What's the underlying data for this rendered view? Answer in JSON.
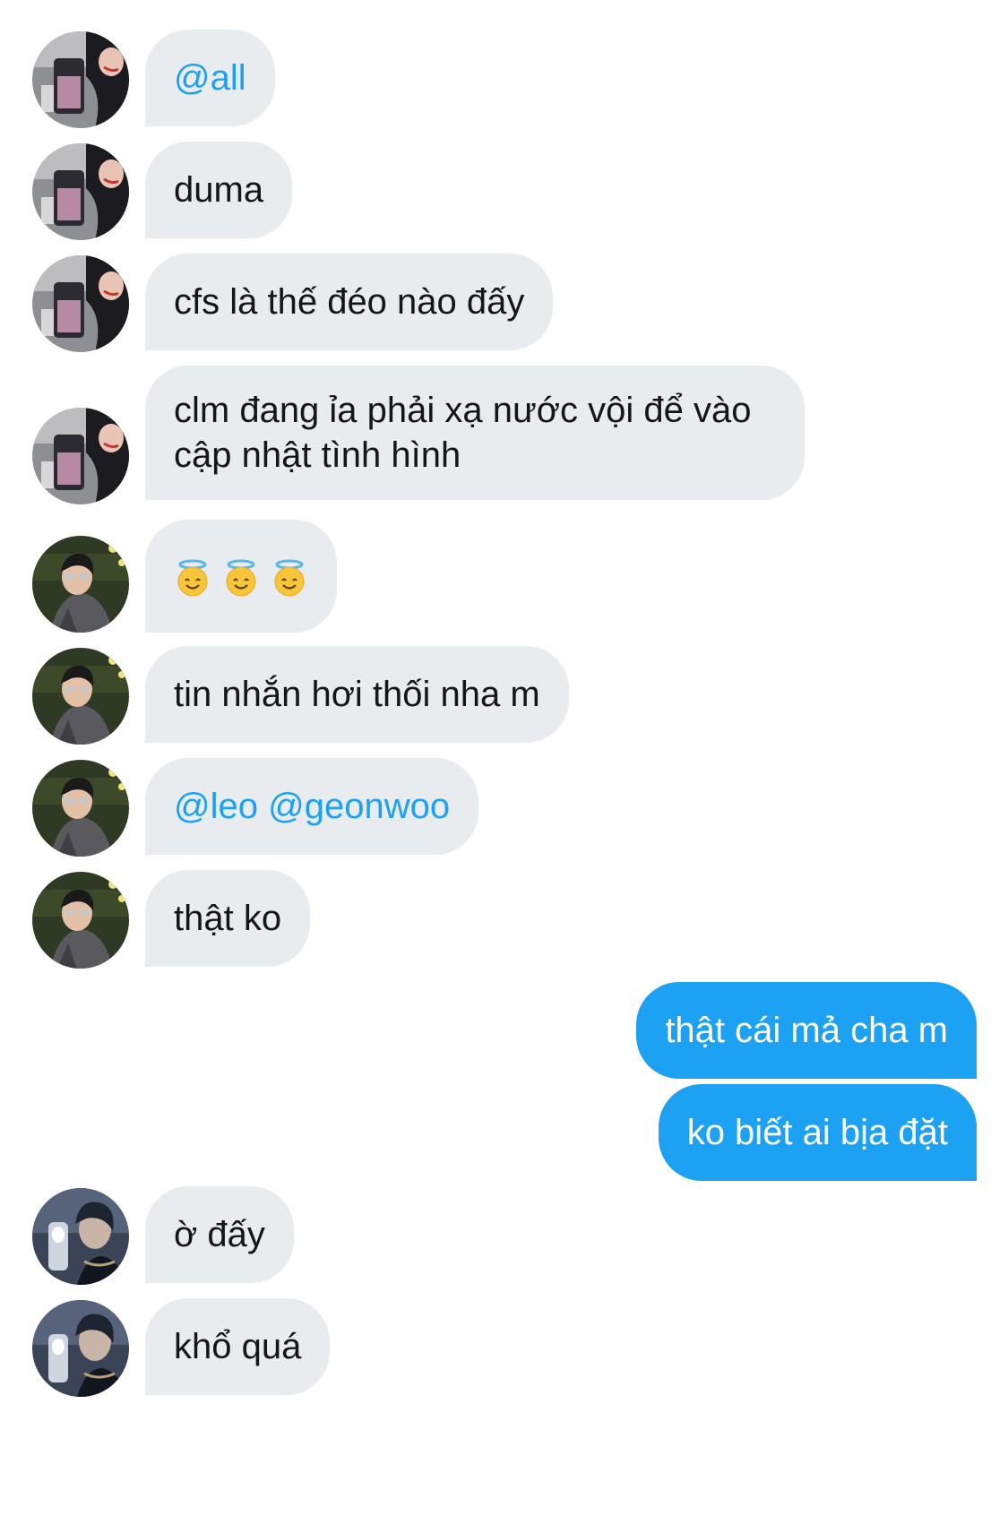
{
  "messages": [
    {
      "sender": "incoming",
      "avatar": "avatar-a",
      "text": "@all",
      "style": "mention"
    },
    {
      "sender": "incoming",
      "avatar": "avatar-a",
      "text": "duma"
    },
    {
      "sender": "incoming",
      "avatar": "avatar-a",
      "text": "cfs là thế đéo nào đấy"
    },
    {
      "sender": "incoming",
      "avatar": "avatar-a",
      "text": "clm đang ỉa phải xạ nước vội để vào cập nhật tình hình"
    },
    {
      "sender": "incoming",
      "avatar": "avatar-b",
      "emoji": [
        "smiling-face-with-halo-icon",
        "smiling-face-with-halo-icon",
        "smiling-face-with-halo-icon"
      ]
    },
    {
      "sender": "incoming",
      "avatar": "avatar-b",
      "text": "tin nhắn hơi thối nha m"
    },
    {
      "sender": "incoming",
      "avatar": "avatar-b",
      "text": "@leo @geonwoo",
      "style": "mention"
    },
    {
      "sender": "incoming",
      "avatar": "avatar-b",
      "text": "thật ko"
    },
    {
      "sender": "outgoing",
      "text": "thật cái mả cha m"
    },
    {
      "sender": "outgoing",
      "text": "ko biết ai bịa đặt"
    },
    {
      "sender": "incoming",
      "avatar": "avatar-c",
      "text": "ờ đấy"
    },
    {
      "sender": "incoming",
      "avatar": "avatar-c",
      "text": "khổ quá"
    }
  ],
  "colors": {
    "incoming_bubble": "#e8ecef",
    "outgoing_bubble": "#1da1f2",
    "mention": "#1da1f2",
    "text": "#14171a"
  }
}
